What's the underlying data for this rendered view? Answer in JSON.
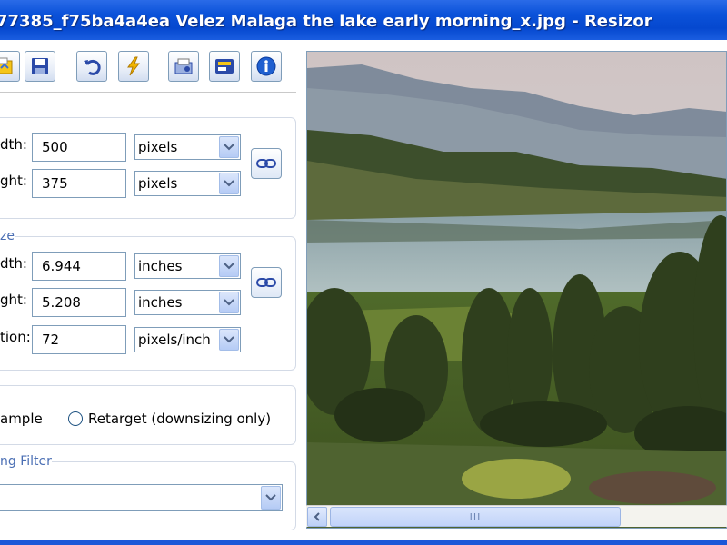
{
  "window": {
    "title": "77385_f75ba4a4ea Velez Malaga the lake early morning_x.jpg - Resizor"
  },
  "toolbar": {
    "buttons": [
      {
        "name": "open-icon",
        "color": "#e8b200"
      },
      {
        "name": "save-icon",
        "color": "#2b4aa8"
      },
      {
        "name": "undo-icon",
        "color": "#2b4aa8"
      },
      {
        "name": "quick-resize-icon",
        "color": "#e8b200"
      },
      {
        "name": "batch-icon",
        "color": "#2b4aa8"
      },
      {
        "name": "settings-icon",
        "color": "#2b4aa8"
      },
      {
        "name": "info-icon",
        "color": "#1f5fd0"
      }
    ]
  },
  "pixel_dimensions": {
    "title": "",
    "width": {
      "label": "dth:",
      "value": "500",
      "unit": "pixels"
    },
    "height": {
      "label": "ght:",
      "value": "375",
      "unit": "pixels"
    }
  },
  "document_size": {
    "title": "ze",
    "width": {
      "label": "dth:",
      "value": "6.944",
      "unit": "inches"
    },
    "height": {
      "label": "ght:",
      "value": "5.208",
      "unit": "inches"
    },
    "resolution": {
      "label": "tion:",
      "value": "72",
      "unit": "pixels/inch"
    }
  },
  "method": {
    "option1": "ample",
    "option2": "Retarget (downsizing only)",
    "selected": "option1"
  },
  "filter": {
    "title": "ng Filter",
    "value": ""
  },
  "scrollbar": {
    "grip": "III"
  },
  "colors": {
    "title_bar": "#0b52d9",
    "group_title": "#4b6fb4",
    "border": "#7f9db9"
  }
}
